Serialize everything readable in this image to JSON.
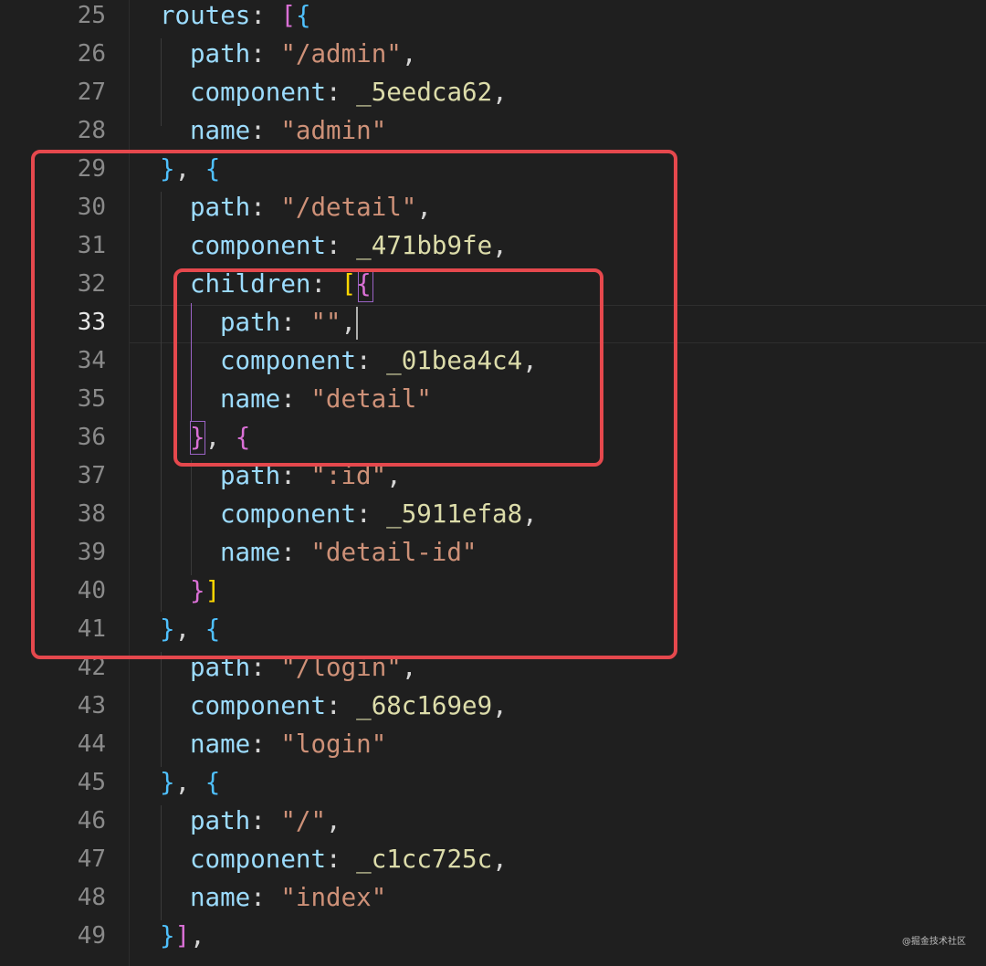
{
  "editor": {
    "lines": [
      {
        "num": "25",
        "active": false,
        "indent": 1,
        "tokens": [
          {
            "t": "routes",
            "c": "key"
          },
          {
            "t": ": ",
            "c": "pun"
          },
          {
            "t": "[",
            "c": "br2"
          },
          {
            "t": "{",
            "c": "br3"
          }
        ]
      },
      {
        "num": "26",
        "active": false,
        "indent": 2,
        "tokens": [
          {
            "t": "path",
            "c": "key"
          },
          {
            "t": ": ",
            "c": "pun"
          },
          {
            "t": "\"/admin\"",
            "c": "str"
          },
          {
            "t": ",",
            "c": "pun"
          }
        ]
      },
      {
        "num": "27",
        "active": false,
        "indent": 2,
        "tokens": [
          {
            "t": "component",
            "c": "key"
          },
          {
            "t": ": ",
            "c": "pun"
          },
          {
            "t": "_5eedca62",
            "c": "id"
          },
          {
            "t": ",",
            "c": "pun"
          }
        ]
      },
      {
        "num": "28",
        "active": false,
        "indent": 2,
        "tokens": [
          {
            "t": "name",
            "c": "key"
          },
          {
            "t": ": ",
            "c": "pun"
          },
          {
            "t": "\"admin\"",
            "c": "str"
          }
        ]
      },
      {
        "num": "29",
        "active": false,
        "indent": 1,
        "tokens": [
          {
            "t": "}",
            "c": "br3"
          },
          {
            "t": ", ",
            "c": "pun"
          },
          {
            "t": "{",
            "c": "br3"
          }
        ]
      },
      {
        "num": "30",
        "active": false,
        "indent": 2,
        "tokens": [
          {
            "t": "path",
            "c": "key"
          },
          {
            "t": ": ",
            "c": "pun"
          },
          {
            "t": "\"/detail\"",
            "c": "str"
          },
          {
            "t": ",",
            "c": "pun"
          }
        ]
      },
      {
        "num": "31",
        "active": false,
        "indent": 2,
        "tokens": [
          {
            "t": "component",
            "c": "key"
          },
          {
            "t": ": ",
            "c": "pun"
          },
          {
            "t": "_471bb9fe",
            "c": "id"
          },
          {
            "t": ",",
            "c": "pun"
          }
        ]
      },
      {
        "num": "32",
        "active": false,
        "indent": 2,
        "tokens": [
          {
            "t": "children",
            "c": "key"
          },
          {
            "t": ": ",
            "c": "pun"
          },
          {
            "t": "[",
            "c": "br1"
          },
          {
            "t": "{",
            "c": "br2"
          }
        ]
      },
      {
        "num": "33",
        "active": true,
        "indent": 3,
        "tokens": [
          {
            "t": "path",
            "c": "key"
          },
          {
            "t": ": ",
            "c": "pun"
          },
          {
            "t": "\"\"",
            "c": "str"
          },
          {
            "t": ",",
            "c": "pun"
          }
        ]
      },
      {
        "num": "34",
        "active": false,
        "indent": 3,
        "tokens": [
          {
            "t": "component",
            "c": "key"
          },
          {
            "t": ": ",
            "c": "pun"
          },
          {
            "t": "_01bea4c4",
            "c": "id"
          },
          {
            "t": ",",
            "c": "pun"
          }
        ]
      },
      {
        "num": "35",
        "active": false,
        "indent": 3,
        "tokens": [
          {
            "t": "name",
            "c": "key"
          },
          {
            "t": ": ",
            "c": "pun"
          },
          {
            "t": "\"detail\"",
            "c": "str"
          }
        ]
      },
      {
        "num": "36",
        "active": false,
        "indent": 2,
        "tokens": [
          {
            "t": "}",
            "c": "br2"
          },
          {
            "t": ", ",
            "c": "pun"
          },
          {
            "t": "{",
            "c": "br2"
          }
        ]
      },
      {
        "num": "37",
        "active": false,
        "indent": 3,
        "tokens": [
          {
            "t": "path",
            "c": "key"
          },
          {
            "t": ": ",
            "c": "pun"
          },
          {
            "t": "\":id\"",
            "c": "str"
          },
          {
            "t": ",",
            "c": "pun"
          }
        ]
      },
      {
        "num": "38",
        "active": false,
        "indent": 3,
        "tokens": [
          {
            "t": "component",
            "c": "key"
          },
          {
            "t": ": ",
            "c": "pun"
          },
          {
            "t": "_5911efa8",
            "c": "id"
          },
          {
            "t": ",",
            "c": "pun"
          }
        ]
      },
      {
        "num": "39",
        "active": false,
        "indent": 3,
        "tokens": [
          {
            "t": "name",
            "c": "key"
          },
          {
            "t": ": ",
            "c": "pun"
          },
          {
            "t": "\"detail-id\"",
            "c": "str"
          }
        ]
      },
      {
        "num": "40",
        "active": false,
        "indent": 2,
        "tokens": [
          {
            "t": "}",
            "c": "br2"
          },
          {
            "t": "]",
            "c": "br1"
          }
        ]
      },
      {
        "num": "41",
        "active": false,
        "indent": 1,
        "tokens": [
          {
            "t": "}",
            "c": "br3"
          },
          {
            "t": ", ",
            "c": "pun"
          },
          {
            "t": "{",
            "c": "br3"
          }
        ]
      },
      {
        "num": "42",
        "active": false,
        "indent": 2,
        "tokens": [
          {
            "t": "path",
            "c": "key"
          },
          {
            "t": ": ",
            "c": "pun"
          },
          {
            "t": "\"/login\"",
            "c": "str"
          },
          {
            "t": ",",
            "c": "pun"
          }
        ]
      },
      {
        "num": "43",
        "active": false,
        "indent": 2,
        "tokens": [
          {
            "t": "component",
            "c": "key"
          },
          {
            "t": ": ",
            "c": "pun"
          },
          {
            "t": "_68c169e9",
            "c": "id"
          },
          {
            "t": ",",
            "c": "pun"
          }
        ]
      },
      {
        "num": "44",
        "active": false,
        "indent": 2,
        "tokens": [
          {
            "t": "name",
            "c": "key"
          },
          {
            "t": ": ",
            "c": "pun"
          },
          {
            "t": "\"login\"",
            "c": "str"
          }
        ]
      },
      {
        "num": "45",
        "active": false,
        "indent": 1,
        "tokens": [
          {
            "t": "}",
            "c": "br3"
          },
          {
            "t": ", ",
            "c": "pun"
          },
          {
            "t": "{",
            "c": "br3"
          }
        ]
      },
      {
        "num": "46",
        "active": false,
        "indent": 2,
        "tokens": [
          {
            "t": "path",
            "c": "key"
          },
          {
            "t": ": ",
            "c": "pun"
          },
          {
            "t": "\"/\"",
            "c": "str"
          },
          {
            "t": ",",
            "c": "pun"
          }
        ]
      },
      {
        "num": "47",
        "active": false,
        "indent": 2,
        "tokens": [
          {
            "t": "component",
            "c": "key"
          },
          {
            "t": ": ",
            "c": "pun"
          },
          {
            "t": "_c1cc725c",
            "c": "id"
          },
          {
            "t": ",",
            "c": "pun"
          }
        ]
      },
      {
        "num": "48",
        "active": false,
        "indent": 2,
        "tokens": [
          {
            "t": "name",
            "c": "key"
          },
          {
            "t": ": ",
            "c": "pun"
          },
          {
            "t": "\"index\"",
            "c": "str"
          }
        ]
      },
      {
        "num": "49",
        "active": false,
        "indent": 1,
        "tokens": [
          {
            "t": "}",
            "c": "br3"
          },
          {
            "t": "]",
            "c": "br2"
          },
          {
            "t": ",",
            "c": "pun"
          }
        ]
      }
    ]
  },
  "colors": {
    "background": "#1f1f1f",
    "highlight_box": "#e5484d",
    "key": "#9cdcfe",
    "string": "#ce9178",
    "identifier": "#dcdcaa"
  },
  "watermark": "@掘金技术社区"
}
